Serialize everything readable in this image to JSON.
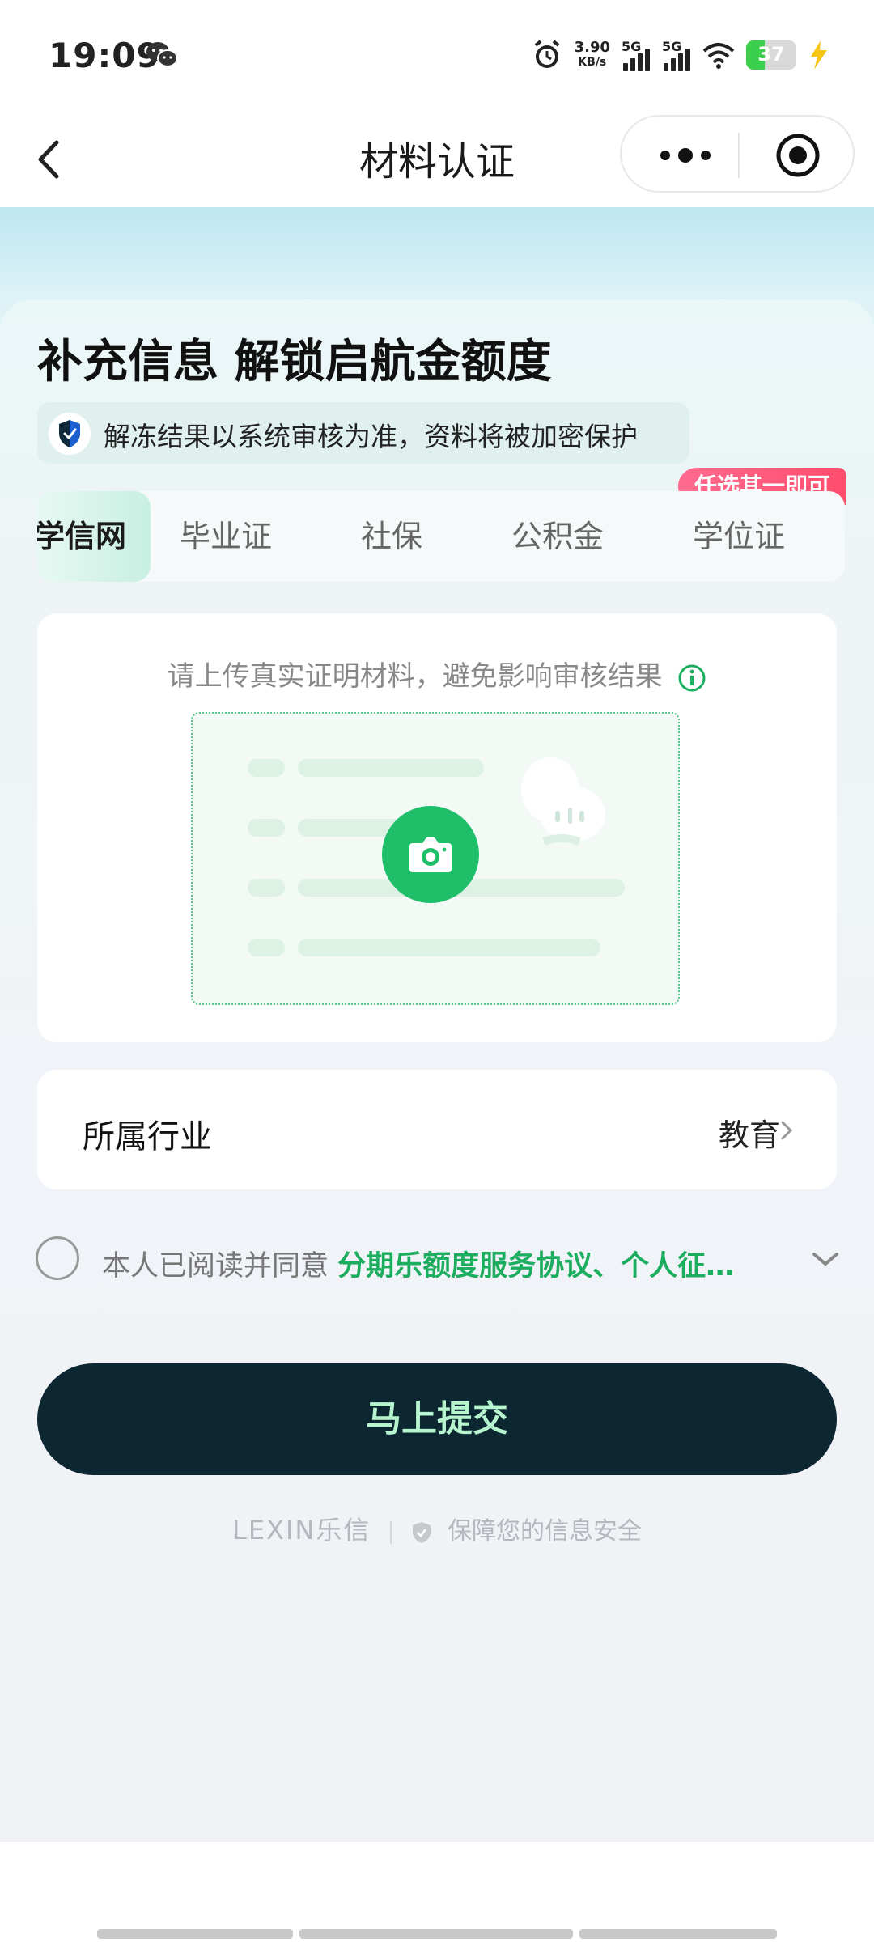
{
  "status_bar": {
    "time": "19:09",
    "net_speed_value": "3.90",
    "net_speed_unit": "KB/s",
    "sim1": "5G",
    "sim2": "5G",
    "battery": "37",
    "battery_level_pct": 37
  },
  "nav": {
    "title": "材料认证",
    "back_icon": "chevron-left-icon",
    "more_icon": "more-dots-icon",
    "close_icon": "target-icon"
  },
  "hero": {
    "headline": "补充信息 解锁启航金额度",
    "notice": "解冻结果以系统审核为准，资料将被加密保护"
  },
  "tabs": {
    "badge": "任选其一即可",
    "items": [
      {
        "label": "学信网",
        "active": true
      },
      {
        "label": "毕业证",
        "active": false
      },
      {
        "label": "社保",
        "active": false
      },
      {
        "label": "公积金",
        "active": false
      },
      {
        "label": "学位证",
        "active": false
      }
    ]
  },
  "upload": {
    "hint": "请上传真实证明材料，避免影响审核结果",
    "camera_icon": "camera-icon"
  },
  "industry": {
    "label": "所属行业",
    "value": "教育"
  },
  "agreement": {
    "prefix": "本人已阅读并同意 ",
    "links": "分期乐额度服务协议、个人征…"
  },
  "submit_label": "马上提交",
  "footer": {
    "brand": "LEXIN乐信",
    "security": "保障您的信息安全"
  },
  "colors": {
    "accent_green": "#1fbf6a",
    "submit_bg": "#0c2731",
    "badge_pink": "#ff4d6d"
  }
}
